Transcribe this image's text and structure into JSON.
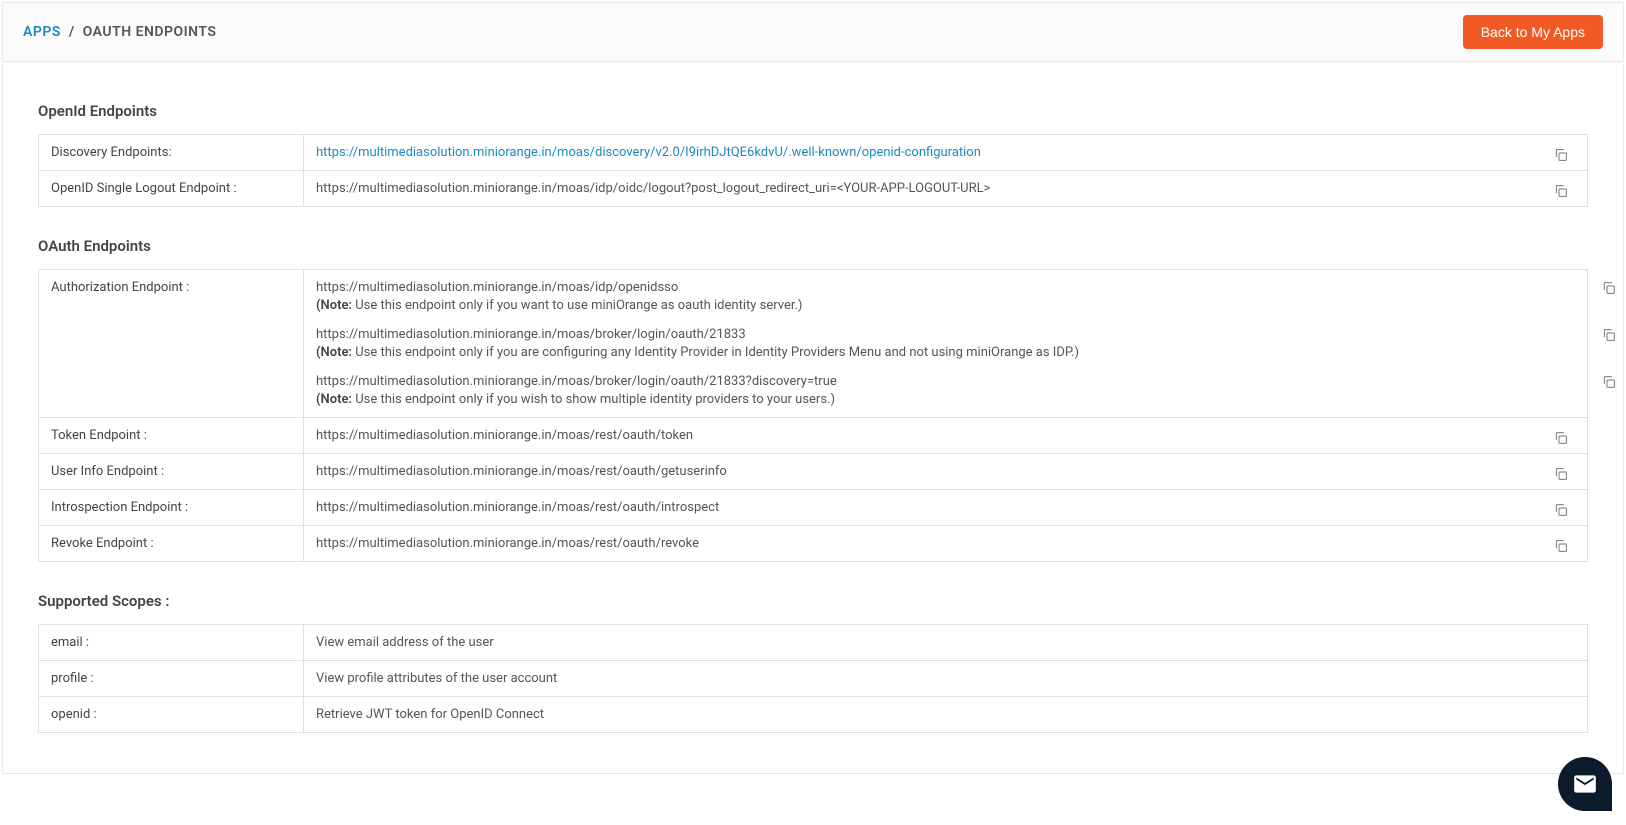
{
  "breadcrumb": {
    "apps": "APPS",
    "sep": "/",
    "current": "OAUTH ENDPOINTS"
  },
  "header": {
    "back_button": "Back to My Apps"
  },
  "sections": {
    "openid_title": "OpenId Endpoints",
    "oauth_title": "OAuth Endpoints",
    "scopes_title": "Supported Scopes :"
  },
  "openid": {
    "discovery_label": "Discovery Endpoints:",
    "discovery_url": "https://multimediasolution.miniorange.in/moas/discovery/v2.0/I9irhDJtQE6kdvU/.well-known/openid-configuration",
    "logout_label": "OpenID Single Logout Endpoint :",
    "logout_url": "https://multimediasolution.miniorange.in/moas/idp/oidc/logout?post_logout_redirect_uri=<YOUR-APP-LOGOUT-URL>"
  },
  "oauth": {
    "auth_label": "Authorization Endpoint :",
    "auth_url_1": "https://multimediasolution.miniorange.in/moas/idp/openidsso",
    "auth_note_1": " Use this endpoint only if you want to use miniOrange as oauth identity server.)",
    "auth_url_2": "https://multimediasolution.miniorange.in/moas/broker/login/oauth/21833",
    "auth_note_2": " Use this endpoint only if you are configuring any Identity Provider in Identity Providers Menu and not using miniOrange as IDP.)",
    "auth_url_3": "https://multimediasolution.miniorange.in/moas/broker/login/oauth/21833?discovery=true",
    "auth_note_3": " Use this endpoint only if you wish to show multiple identity providers to your users.)",
    "token_label": "Token Endpoint :",
    "token_url": "https://multimediasolution.miniorange.in/moas/rest/oauth/token",
    "userinfo_label": "User Info Endpoint :",
    "userinfo_url": "https://multimediasolution.miniorange.in/moas/rest/oauth/getuserinfo",
    "introspect_label": "Introspection Endpoint :",
    "introspect_url": "https://multimediasolution.miniorange.in/moas/rest/oauth/introspect",
    "revoke_label": "Revoke Endpoint :",
    "revoke_url": "https://multimediasolution.miniorange.in/moas/rest/oauth/revoke",
    "note_prefix": "(Note:"
  },
  "scopes": [
    {
      "name": "email :",
      "desc": "View email address of the user"
    },
    {
      "name": "profile :",
      "desc": "View profile attributes of the user account"
    },
    {
      "name": "openid :",
      "desc": "Retrieve JWT token for OpenID Connect"
    }
  ]
}
